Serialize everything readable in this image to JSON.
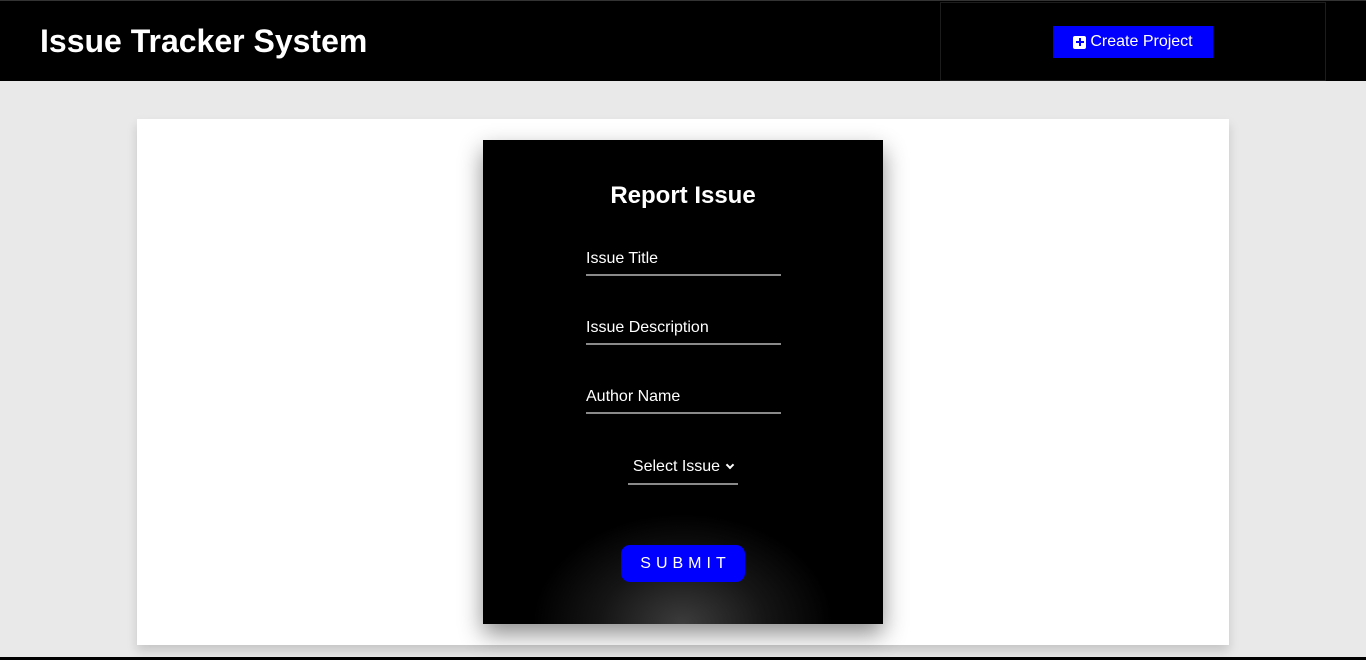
{
  "header": {
    "title": "Issue Tracker System",
    "create_button_label": "Create Project",
    "create_button_icon": "plus-square-icon"
  },
  "form": {
    "heading": "Report Issue",
    "issue_title_placeholder": "Issue Title",
    "issue_description_placeholder": "Issue Description",
    "author_name_placeholder": "Author Name",
    "select_label": "Select Issue",
    "submit_label": "SUBMIT"
  },
  "colors": {
    "accent": "#0000ff",
    "navbar": "#000000",
    "page_background": "#e9e9e9",
    "card": "#000000"
  }
}
